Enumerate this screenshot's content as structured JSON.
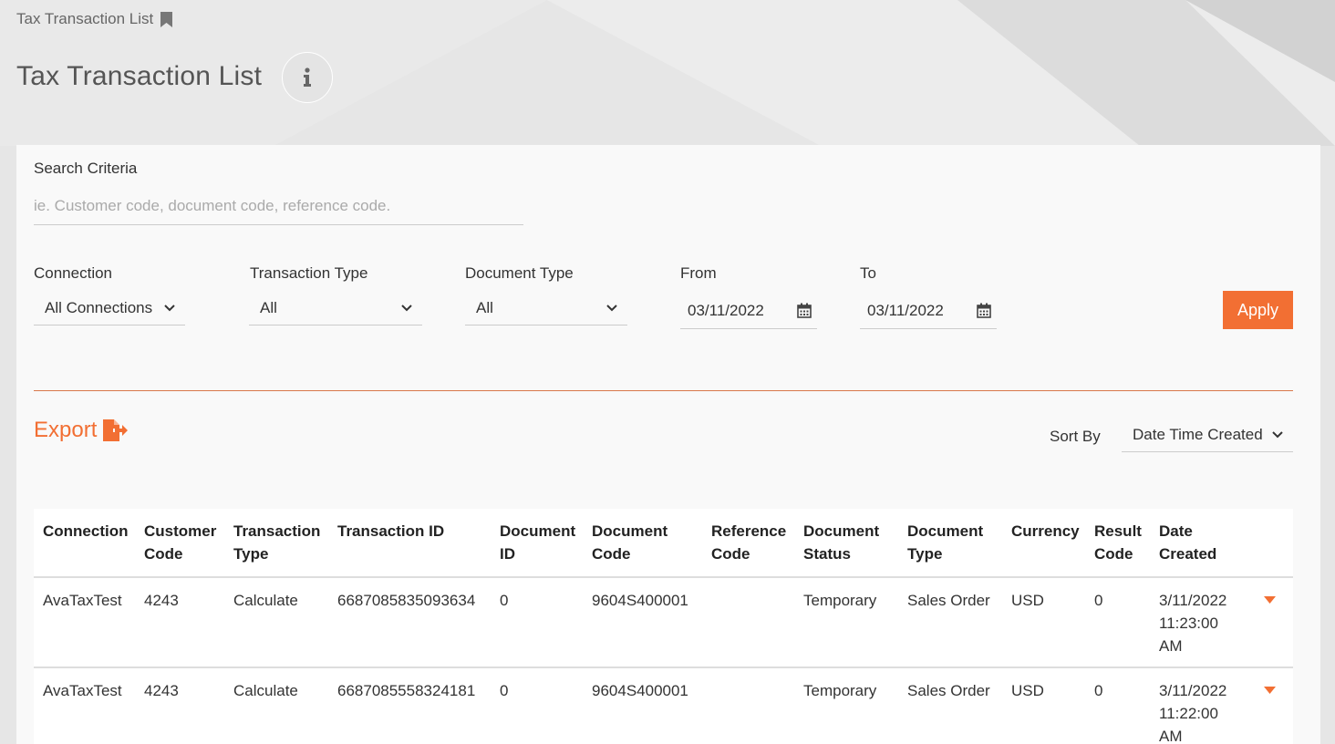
{
  "breadcrumb": {
    "label": "Tax Transaction List",
    "icon": "bookmark-icon"
  },
  "page": {
    "title": "Tax Transaction List",
    "info_icon": "info-icon"
  },
  "search": {
    "label": "Search Criteria",
    "value": "",
    "placeholder": "ie. Customer code, document code, reference code."
  },
  "filters": {
    "connection": {
      "label": "Connection",
      "value": "All Connections"
    },
    "transaction_type": {
      "label": "Transaction Type",
      "value": "All"
    },
    "document_type": {
      "label": "Document Type",
      "value": "All"
    },
    "from": {
      "label": "From",
      "value": "03/11/2022"
    },
    "to": {
      "label": "To",
      "value": "03/11/2022"
    },
    "apply_label": "Apply"
  },
  "export": {
    "label": "Export",
    "icon": "file-export-icon"
  },
  "sort": {
    "label": "Sort By",
    "value": "Date Time Created"
  },
  "table": {
    "headers": [
      [
        "Connection",
        ""
      ],
      [
        "Customer",
        "Code"
      ],
      [
        "Transaction",
        "Type"
      ],
      [
        "Transaction ID",
        ""
      ],
      [
        "Document",
        "ID"
      ],
      [
        "Document",
        "Code"
      ],
      [
        "Reference",
        "Code"
      ],
      [
        "Document",
        "Status"
      ],
      [
        "Document",
        "Type"
      ],
      [
        "Currency",
        ""
      ],
      [
        "Result",
        "Code"
      ],
      [
        "Date",
        "Created"
      ]
    ],
    "rows": [
      {
        "connection": "AvaTaxTest",
        "customer_code": "4243",
        "transaction_type": "Calculate",
        "transaction_id": "6687085835093634",
        "document_id": "0",
        "document_code": "9604S400001",
        "reference_code": "",
        "document_status": "Temporary",
        "document_type": "Sales Order",
        "currency": "USD",
        "result_code": "0",
        "date_created": [
          "3/11/2022",
          "11:23:00",
          "AM"
        ]
      },
      {
        "connection": "AvaTaxTest",
        "customer_code": "4243",
        "transaction_type": "Calculate",
        "transaction_id": "6687085558324181",
        "document_id": "0",
        "document_code": "9604S400001",
        "reference_code": "",
        "document_status": "Temporary",
        "document_type": "Sales Order",
        "currency": "USD",
        "result_code": "0",
        "date_created": [
          "3/11/2022",
          "11:22:00",
          "AM"
        ]
      }
    ]
  },
  "colors": {
    "accent": "#f26f33",
    "divider": "#d9784a",
    "panel": "#f9f9f9"
  }
}
